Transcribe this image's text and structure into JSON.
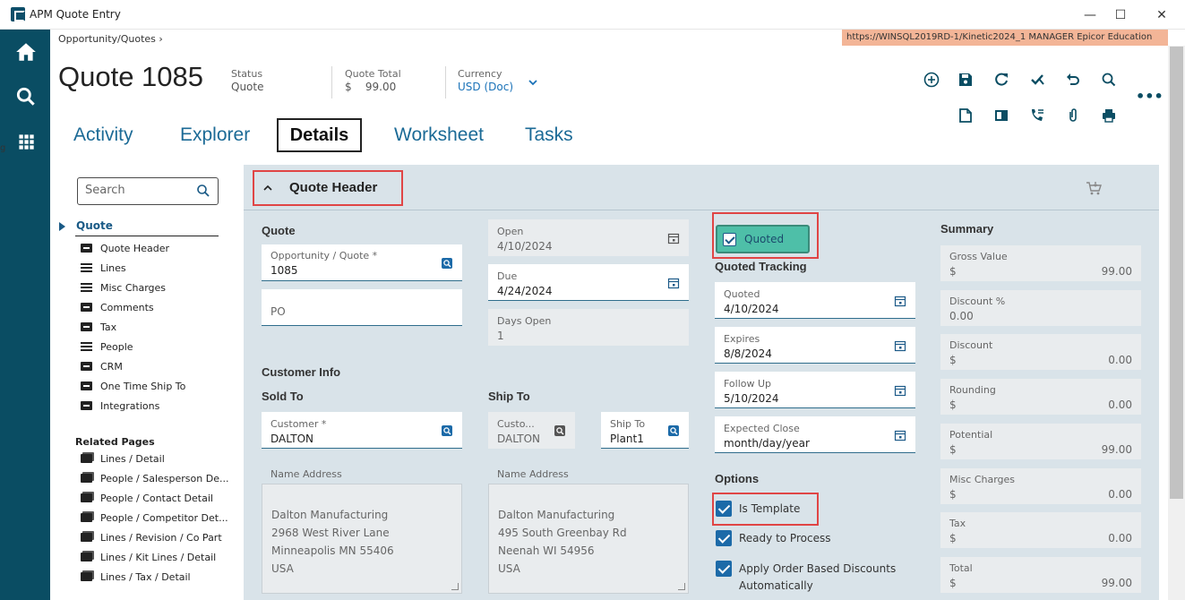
{
  "window": {
    "title": "APM Quote Entry",
    "min": "—",
    "max": "☐",
    "close": "✕"
  },
  "breadcrumb": "Opportunity/Quotes  ›",
  "environment": "https://WINSQL2019RD-1/Kinetic2024_1   MANAGER   Epicor Education",
  "header": {
    "title": "Quote 1085",
    "status_label": "Status",
    "status_value": "Quote",
    "total_label": "Quote Total",
    "total_value": "$    99.00",
    "currency_label": "Currency",
    "currency_value": "USD (Doc)",
    "more": "•••"
  },
  "tabs": [
    "Activity",
    "Explorer",
    "Details",
    "Worksheet",
    "Tasks"
  ],
  "tree": {
    "search_placeholder": "Search",
    "root": "Quote",
    "items": [
      {
        "label": "Quote Header",
        "icon": "card"
      },
      {
        "label": "Lines",
        "icon": "list"
      },
      {
        "label": "Misc Charges",
        "icon": "list"
      },
      {
        "label": "Comments",
        "icon": "card"
      },
      {
        "label": "Tax",
        "icon": "card"
      },
      {
        "label": "People",
        "icon": "list"
      },
      {
        "label": "CRM",
        "icon": "card"
      },
      {
        "label": "One Time Ship To",
        "icon": "card"
      },
      {
        "label": "Integrations",
        "icon": "card"
      }
    ],
    "related_header": "Related Pages",
    "related": [
      "Lines / Detail",
      "People / Salesperson De...",
      "People / Contact Detail",
      "People / Competitor Det...",
      "Lines / Revision / Co Part",
      "Lines / Kit Lines / Detail",
      "Lines / Tax / Detail"
    ]
  },
  "section": {
    "title": "Quote Header"
  },
  "quote_group": {
    "title": "Quote",
    "opp_label": "Opportunity / Quote *",
    "opp_value": "1085",
    "po_placeholder": "PO"
  },
  "dates": {
    "open_label": "Open",
    "open_value": "4/10/2024",
    "due_label": "Due",
    "due_value": "4/24/2024",
    "days_open_label": "Days Open",
    "days_open_value": "1"
  },
  "customer": {
    "group_title": "Customer Info",
    "sold_to_title": "Sold To",
    "customer_label": "Customer *",
    "customer_value": "DALTON",
    "name_address_label": "Name Address",
    "sold_address": [
      "Dalton Manufacturing",
      "2968 West River Lane",
      "Minneapolis MN 55406",
      "USA"
    ]
  },
  "ship_to": {
    "title": "Ship To",
    "customer_label": "Custo...",
    "customer_value": "DALTON",
    "shipto_label": "Ship To",
    "shipto_value": "Plant1",
    "name_address_label": "Name Address",
    "address": [
      "Dalton Manufacturing",
      "495 South Greenbay Rd",
      "Neenah WI 54956",
      "USA"
    ]
  },
  "quoted": {
    "checkbox_label": "Quoted",
    "tracking_title": "Quoted Tracking",
    "quoted_label": "Quoted",
    "quoted_value": "4/10/2024",
    "expires_label": "Expires",
    "expires_value": "8/8/2024",
    "follow_label": "Follow Up",
    "follow_value": "5/10/2024",
    "close_label": "Expected Close",
    "close_value": "month/day/year"
  },
  "options": {
    "title": "Options",
    "is_template": "Is Template",
    "ready": "Ready to Process",
    "apply_line1": "Apply Order Based Discounts",
    "apply_line2": "Automatically"
  },
  "summary": {
    "title": "Summary",
    "rows": [
      {
        "label": "Gross Value",
        "cur": "$",
        "value": "99.00"
      },
      {
        "label": "Discount %",
        "cur": "0.00",
        "value": ""
      },
      {
        "label": "Discount",
        "cur": "$",
        "value": "0.00"
      },
      {
        "label": "Rounding",
        "cur": "$",
        "value": "0.00"
      },
      {
        "label": "Potential",
        "cur": "$",
        "value": "99.00"
      },
      {
        "label": "Misc Charges",
        "cur": "$",
        "value": "0.00"
      },
      {
        "label": "Tax",
        "cur": "$",
        "value": "0.00"
      },
      {
        "label": "Total",
        "cur": "$",
        "value": "99.00"
      }
    ]
  },
  "colors": {
    "nav": "#0a4d63",
    "accent": "#1b6a96",
    "highlight": "#e04545",
    "quoted_green": "#4ebfa8",
    "env": "#f3b597"
  }
}
